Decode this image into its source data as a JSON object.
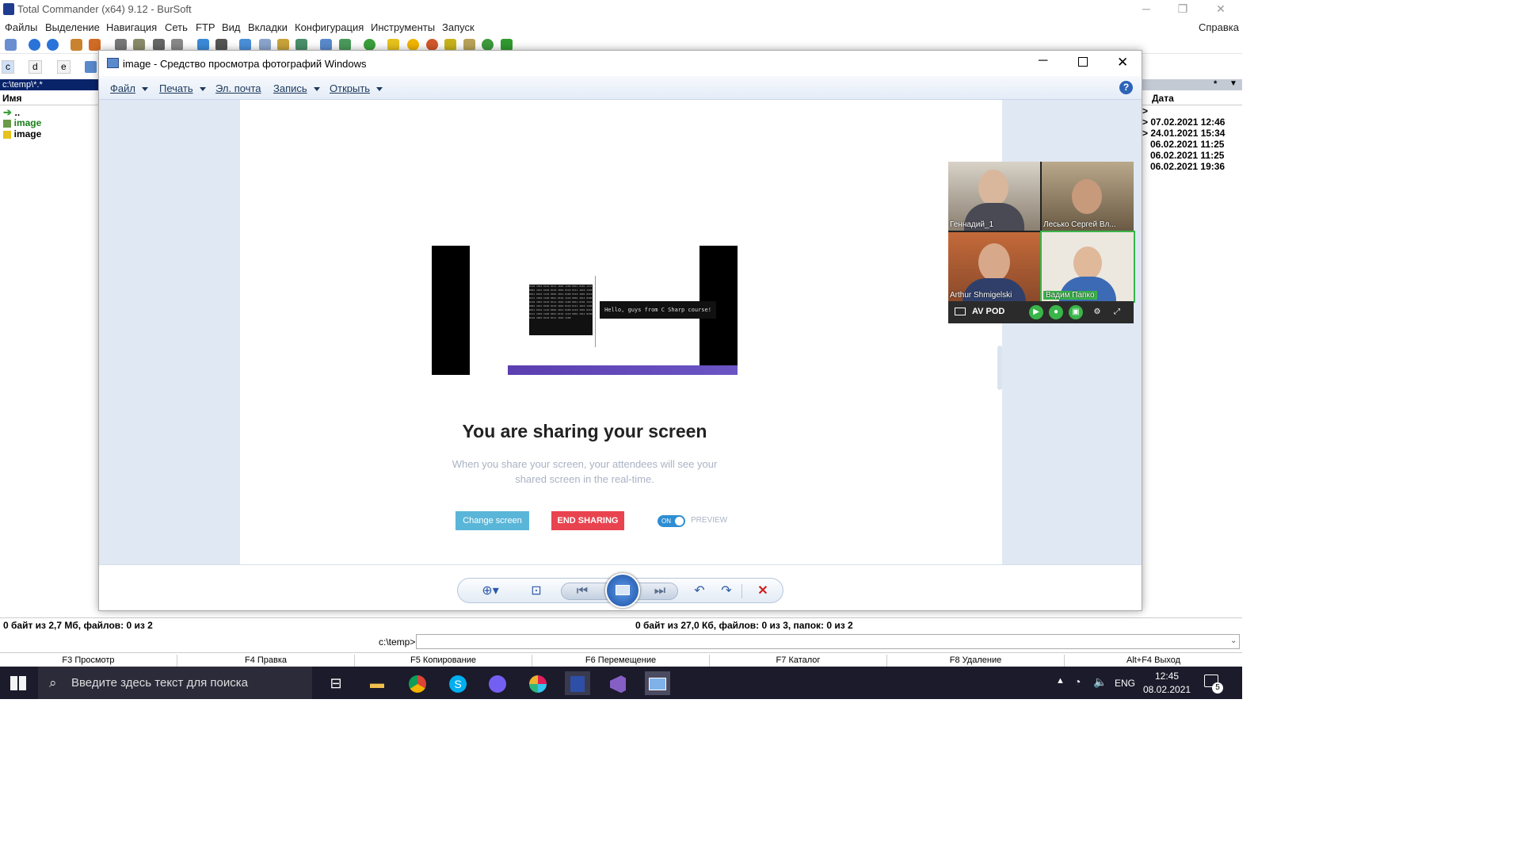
{
  "tc": {
    "title": "Total Commander (x64) 9.12 - BurSoft",
    "menu": [
      "Файлы",
      "Выделение",
      "Навигация",
      "Сеть",
      "FTP",
      "Вид",
      "Вкладки",
      "Конфигурация",
      "Инструменты",
      "Запуск"
    ],
    "help_menu": "Справка",
    "drives": [
      "c",
      "d",
      "e"
    ],
    "left_path": "c:\\temp\\*.*",
    "col_name": "Имя",
    "col_date": "Дата",
    "files": [
      "..",
      "image",
      "image"
    ],
    "dates": [
      ">",
      "> 07.02.2021 12:46",
      "> 24.01.2021 15:34",
      "06.02.2021 11:25",
      "06.02.2021 11:25",
      "06.02.2021 19:36"
    ],
    "right_filter": "*",
    "status_left": "0 байт из 2,7 Мб, файлов: 0 из 2",
    "status_right": "0 байт из 27,0 Кб, файлов: 0 из 3, папок: 0 из 2",
    "cmd_prompt": "c:\\temp>",
    "fkeys": [
      "F3 Просмотр",
      "F4 Правка",
      "F5 Копирование",
      "F6 Перемещение",
      "F7 Каталог",
      "F8 Удаление",
      "Alt+F4 Выход"
    ]
  },
  "viewer": {
    "title": "image - Средство просмотра фотографий Windows",
    "menu": [
      {
        "label": "Файл",
        "arrow": true
      },
      {
        "label": "Печать",
        "arrow": true
      },
      {
        "label": "Эл. почта",
        "arrow": false
      },
      {
        "label": "Запись",
        "arrow": true
      },
      {
        "label": "Открыть",
        "arrow": true
      }
    ],
    "help": "?"
  },
  "content": {
    "hello_text": "Hello, guys from C Sharp course!",
    "share_title": "You are sharing your screen",
    "share_desc": "When you share your screen, your attendees will see your shared screen in the real-time.",
    "btn_change": "Change screen",
    "btn_end": "END SHARING",
    "toggle": "ON",
    "preview": "PREVIEW",
    "participants": [
      "Геннадий_1",
      "Лесько Сергей Вл...",
      "Arthur Shmigelski",
      "Вадим Папко"
    ],
    "room": "AV POD"
  },
  "taskbar": {
    "search_placeholder": "Введите здесь текст для поиска",
    "lang": "ENG",
    "time": "12:45",
    "date": "08.02.2021",
    "notifications": "5"
  },
  "colors": {
    "accent": "#2d63b7",
    "end": "#e8434f",
    "change": "#5ab6d8"
  }
}
